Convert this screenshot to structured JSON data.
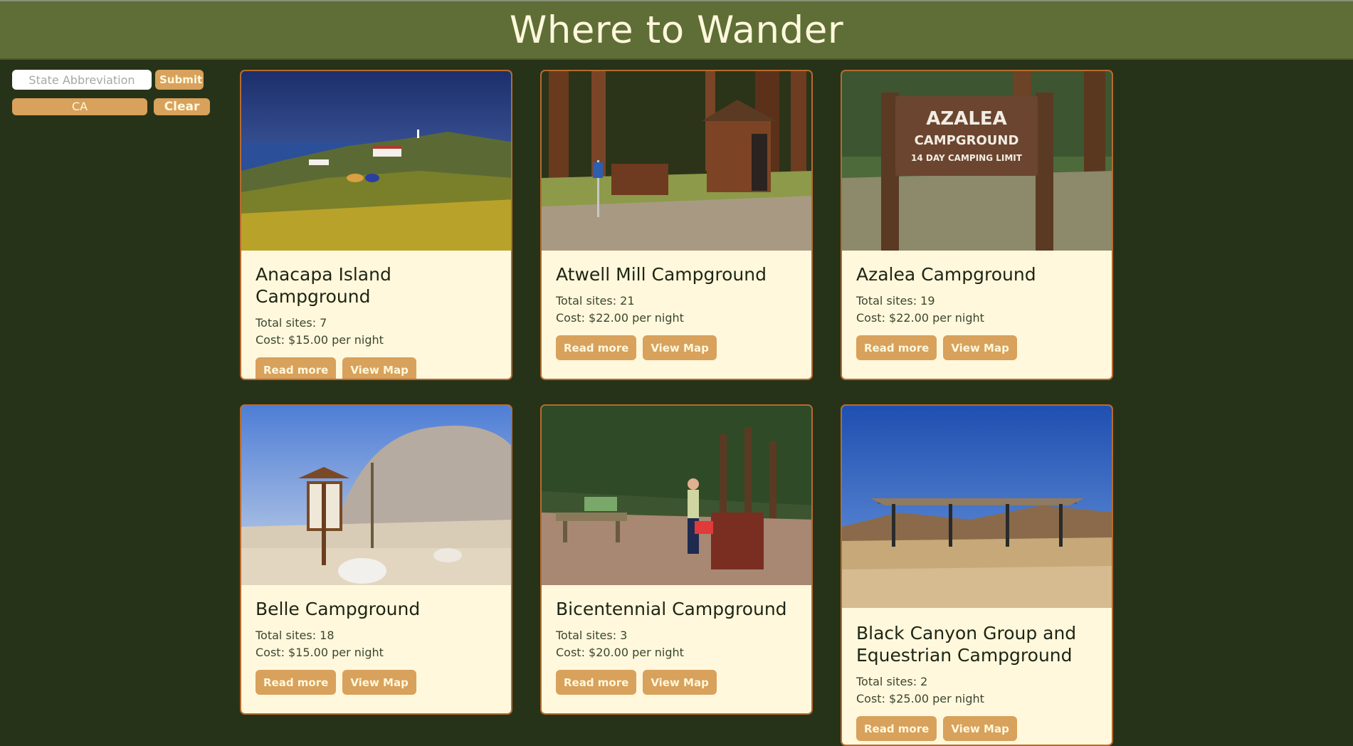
{
  "header": {
    "title": "Where to Wander"
  },
  "search": {
    "placeholder": "State Abbreviation",
    "submit_label": "Submit",
    "active_filter": "CA",
    "clear_label": "Clear"
  },
  "campgrounds": [
    {
      "name": "Anacapa Island Campground",
      "sites": "Total sites: 7",
      "cost": "Cost: $15.00 per night",
      "read_more": "Read more",
      "view_map": "View Map"
    },
    {
      "name": "Atwell Mill Campground",
      "sites": "Total sites: 21",
      "cost": "Cost: $22.00 per night",
      "read_more": "Read more",
      "view_map": "View Map"
    },
    {
      "name": "Azalea Campground",
      "sites": "Total sites: 19",
      "cost": "Cost: $22.00 per night",
      "read_more": "Read more",
      "view_map": "View Map",
      "sign_lines": [
        "AZALEA",
        "CAMPGROUND",
        "14 DAY CAMPING LIMIT"
      ]
    },
    {
      "name": "Belle Campground",
      "sites": "Total sites: 18",
      "cost": "Cost: $15.00 per night",
      "read_more": "Read more",
      "view_map": "View Map"
    },
    {
      "name": "Bicentennial Campground",
      "sites": "Total sites: 3",
      "cost": "Cost: $20.00 per night",
      "read_more": "Read more",
      "view_map": "View Map"
    },
    {
      "name": "Black Canyon Group and Equestrian Campground",
      "sites": "Total sites: 2",
      "cost": "Cost: $25.00 per night",
      "read_more": "Read more",
      "view_map": "View Map"
    }
  ],
  "colors": {
    "background": "#263318",
    "header": "#5e6e36",
    "card": "#fff8dc",
    "accent": "#d8a15c",
    "card_border": "#b86a2e"
  }
}
